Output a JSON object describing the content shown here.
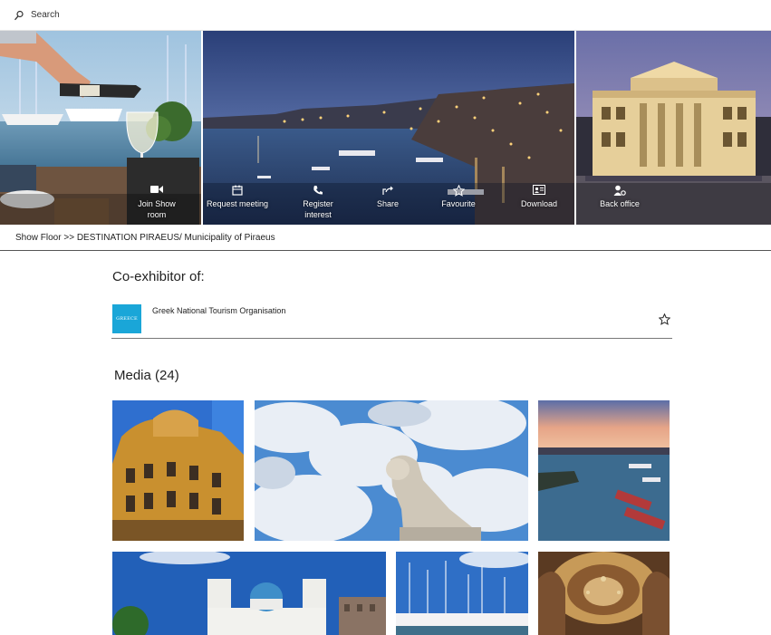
{
  "search": {
    "label": "Search"
  },
  "actions": [
    {
      "label": "Join Show room",
      "icon": "video-camera-icon"
    },
    {
      "label": "Request meeting",
      "icon": "calendar-icon"
    },
    {
      "label": "Register interest",
      "icon": "phone-icon"
    },
    {
      "label": "Share",
      "icon": "share-icon"
    },
    {
      "label": "Favourite",
      "icon": "star-icon"
    },
    {
      "label": "Download",
      "icon": "contact-card-icon"
    },
    {
      "label": "Back office",
      "icon": "user-settings-icon"
    }
  ],
  "breadcrumb": {
    "root": "Show Floor",
    "separator": ">>",
    "path": "DESTINATION PIRAEUS/ Municipality of Piraeus"
  },
  "coexhibitor": {
    "title": "Co-exhibitor of:",
    "org_name": "Greek National Tourism Organisation",
    "logo_text": "GREECE",
    "logo_color": "#1aa6d8"
  },
  "media": {
    "title": "Media (24)"
  }
}
